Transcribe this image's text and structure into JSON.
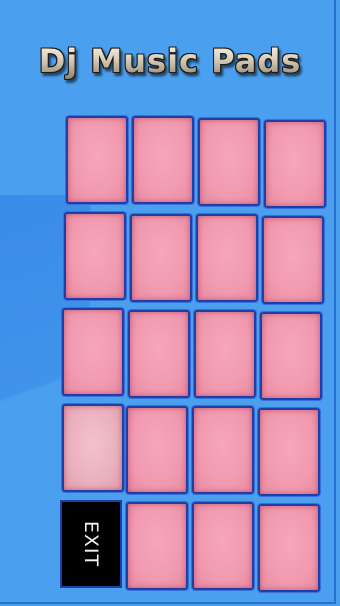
{
  "app": {
    "title": "Dj Music Pads"
  },
  "colors": {
    "background": "#4aa0ee",
    "pad": "#f19aaf",
    "pad_border": "#1f3fa8",
    "exit_bg": "#000000"
  },
  "grid": {
    "rows": 5,
    "columns": 4,
    "pad_count": 19
  },
  "exit_button": {
    "label": "EXIT"
  }
}
